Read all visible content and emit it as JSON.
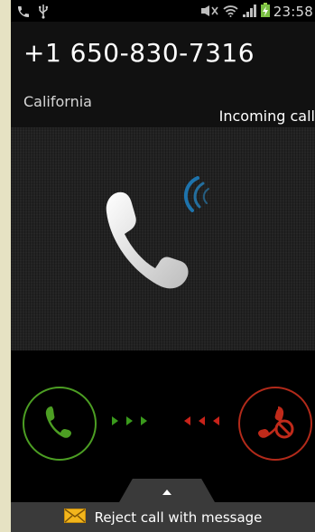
{
  "status_bar": {
    "time": "23:58",
    "left_icons": [
      "call-icon",
      "usb-icon"
    ],
    "right_icons": [
      "mute-icon",
      "wifi-icon",
      "signal-icon",
      "battery-charging-icon"
    ]
  },
  "caller": {
    "number": "+1 650-830-7316",
    "location": "California",
    "status": "Incoming call"
  },
  "controls": {
    "accept_icon": "phone-icon",
    "reject_icon": "phone-reject-icon",
    "accept_color": "#4c9e23",
    "reject_color": "#b22a1a"
  },
  "reject_message": {
    "label": "Reject call with message",
    "icon": "envelope-icon"
  }
}
